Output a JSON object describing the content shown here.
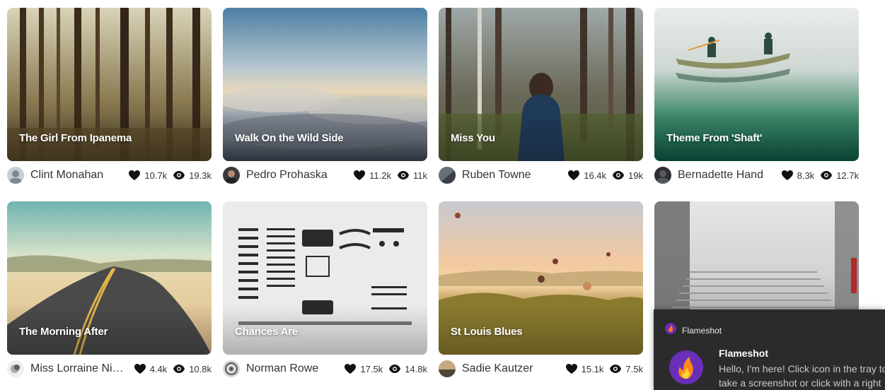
{
  "cards": [
    {
      "title": "The Girl From Ipanema",
      "author": "Clint Monahan",
      "likes": "10.7k",
      "views": "19.3k"
    },
    {
      "title": "Walk On the Wild Side",
      "author": "Pedro Prohaska",
      "likes": "11.2k",
      "views": "11k"
    },
    {
      "title": "Miss You",
      "author": "Ruben Towne",
      "likes": "16.4k",
      "views": "19k"
    },
    {
      "title": "Theme From 'Shaft'",
      "author": "Bernadette Hand",
      "likes": "8.3k",
      "views": "12.7k"
    },
    {
      "title": "The Morning After",
      "author": "Miss Lorraine Nienow",
      "likes": "4.4k",
      "views": "10.8k"
    },
    {
      "title": "Chances Are",
      "author": "Norman Rowe",
      "likes": "17.5k",
      "views": "14.8k"
    },
    {
      "title": "St Louis Blues",
      "author": "Sadie Kautzer",
      "likes": "15.1k",
      "views": "7.5k"
    },
    {
      "title": "",
      "author": "",
      "likes": "",
      "views": ""
    }
  ],
  "notification": {
    "app": "Flameshot",
    "title": "Flameshot",
    "line1": "Hello, I'm here! Click icon in the tray to",
    "line2": "take a screenshot or click with a right"
  },
  "icons": {
    "like": "heart-icon",
    "view": "eye-icon"
  }
}
